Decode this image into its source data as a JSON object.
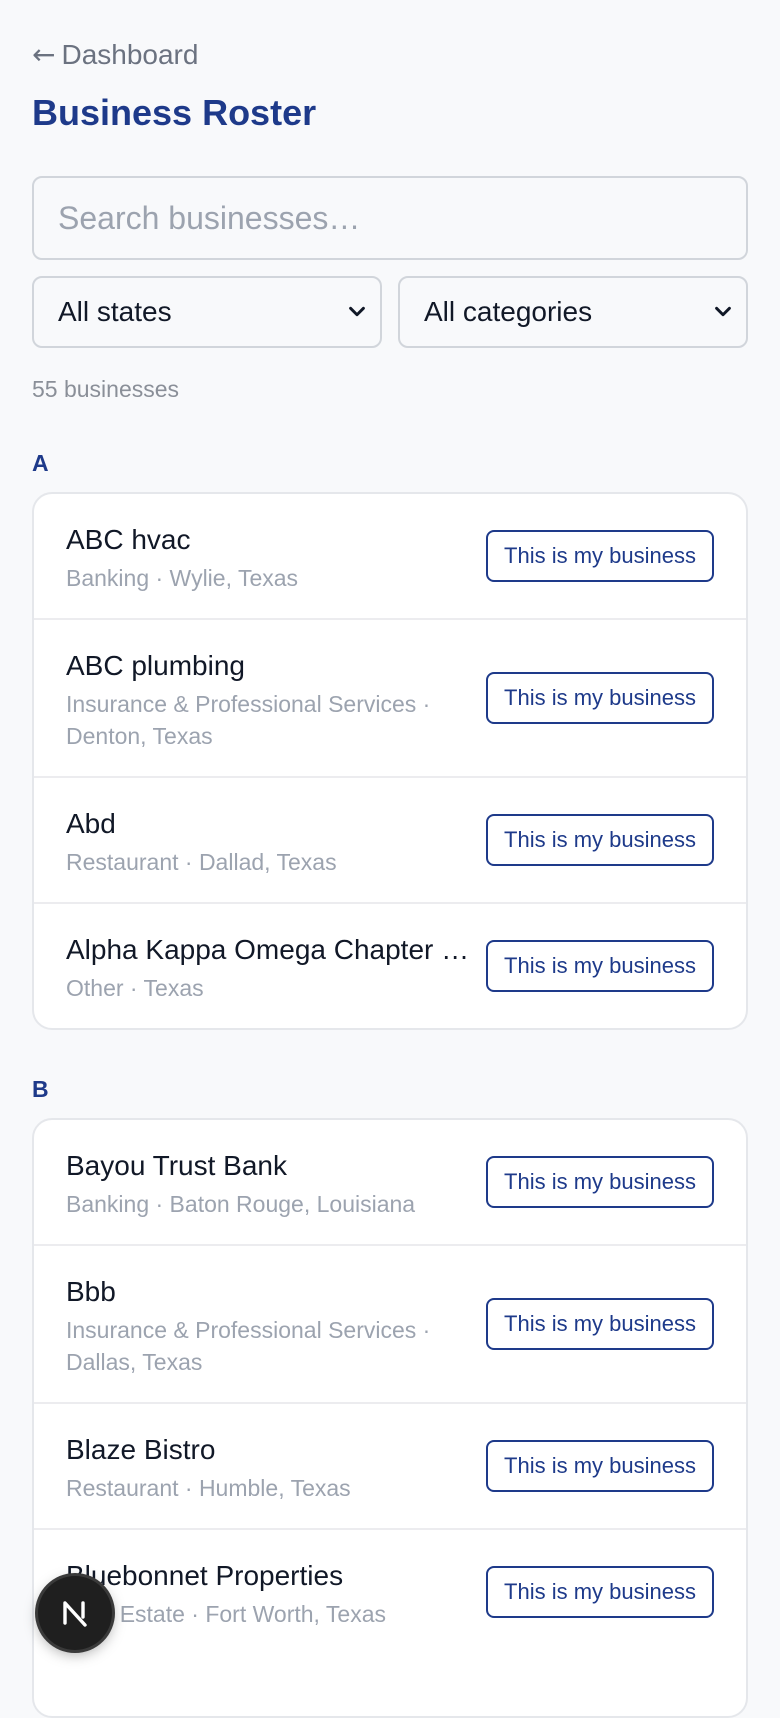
{
  "nav": {
    "back_arrow": "←",
    "back_label": "Dashboard"
  },
  "header": {
    "title": "Business Roster"
  },
  "search": {
    "placeholder": "Search businesses…",
    "value": ""
  },
  "filters": {
    "state_selected": "All states",
    "category_selected": "All categories"
  },
  "result_count": "55 businesses",
  "sections": [
    {
      "letter": "A",
      "businesses": [
        {
          "name": "ABC hvac",
          "meta": "Banking · Wylie, Texas",
          "action": "This is my business"
        },
        {
          "name": "ABC plumbing",
          "meta": "Insurance & Professional Services · Denton, Texas",
          "action": "This is my business"
        },
        {
          "name": "Abd",
          "meta": "Restaurant · Dallad, Texas",
          "action": "This is my business"
        },
        {
          "name": "Alpha Kappa Omega Chapter …",
          "meta": "Other · Texas",
          "action": "This is my business"
        }
      ]
    },
    {
      "letter": "B",
      "businesses": [
        {
          "name": "Bayou Trust Bank",
          "meta": "Banking · Baton Rouge, Louisiana",
          "action": "This is my business"
        },
        {
          "name": "Bbb",
          "meta": "Insurance & Professional Services · Dallas, Texas",
          "action": "This is my business"
        },
        {
          "name": "Blaze Bistro",
          "meta": "Restaurant · Humble, Texas",
          "action": "This is my business"
        },
        {
          "name": "Bluebonnet Properties",
          "meta": "Real Estate · Fort Worth, Texas",
          "action": "This is my business"
        }
      ]
    }
  ],
  "fab": {
    "icon": "nextjs-logo-icon",
    "letter": "N"
  },
  "colors": {
    "accent": "#1e3a8a",
    "muted_text": "#9ca3af",
    "background": "#f8f9fb"
  }
}
